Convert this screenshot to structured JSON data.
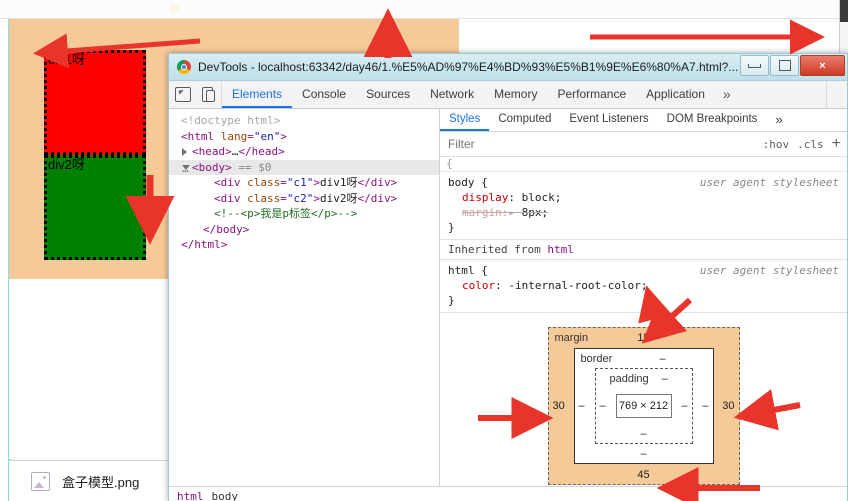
{
  "bookmarks": {
    "items": [
      {
        "label": "   "
      },
      {
        "label": "  "
      },
      {
        "label": "  "
      },
      {
        "label": "  "
      },
      {
        "label": "  "
      },
      {
        "label": "  "
      }
    ]
  },
  "page": {
    "div1_text": "div1呀",
    "div2_text": "div2呀",
    "div1_color": "#ff0000",
    "div2_color": "#008000",
    "body_background": "#f6c998",
    "border_style": "3px dotted #000000"
  },
  "download_shelf": {
    "file_name": "盒子模型.png",
    "icon": "image-file-icon"
  },
  "devtools": {
    "window_title": "DevTools - localhost:63342/day46/1.%E5%AD%97%E4%BD%93%E5%B1%9E%E6%80%A7.html?...",
    "window_controls": {
      "minimize": "minimize-icon",
      "maximize": "maximize-icon",
      "close": "×"
    },
    "toolbar_icons": [
      {
        "name": "inspect-element-icon"
      },
      {
        "name": "device-toolbar-icon"
      }
    ],
    "tabs": [
      {
        "label": "Elements",
        "active": true
      },
      {
        "label": "Console",
        "active": false
      },
      {
        "label": "Sources",
        "active": false
      },
      {
        "label": "Network",
        "active": false
      },
      {
        "label": "Memory",
        "active": false
      },
      {
        "label": "Performance",
        "active": false
      },
      {
        "label": "Application",
        "active": false
      },
      {
        "label": "»",
        "active": false
      }
    ],
    "kebab": "more-options-icon",
    "dom_tree": [
      {
        "indent": 0,
        "parts": [
          {
            "t": "doctype",
            "v": "<!doctype html>"
          }
        ]
      },
      {
        "indent": 0,
        "parts": [
          {
            "t": "punc",
            "v": "<"
          },
          {
            "t": "tag",
            "v": "html"
          },
          {
            "t": "sp",
            "v": " "
          },
          {
            "t": "attrname",
            "v": "lang"
          },
          {
            "t": "punc",
            "v": "="
          },
          {
            "t": "attrval",
            "v": "\"en\""
          },
          {
            "t": "punc",
            "v": ">"
          }
        ]
      },
      {
        "indent": 1,
        "triangle": "closed",
        "parts": [
          {
            "t": "punc",
            "v": "<"
          },
          {
            "t": "tag",
            "v": "head"
          },
          {
            "t": "punc",
            "v": ">"
          },
          {
            "t": "txt",
            "v": "…"
          },
          {
            "t": "punc",
            "v": "</"
          },
          {
            "t": "tag",
            "v": "head"
          },
          {
            "t": "punc",
            "v": ">"
          }
        ]
      },
      {
        "indent": 1,
        "triangle": "open",
        "selected": true,
        "prefix": "…",
        "parts": [
          {
            "t": "punc",
            "v": "<"
          },
          {
            "t": "tag",
            "v": "body"
          },
          {
            "t": "punc",
            "v": ">"
          },
          {
            "t": "sp",
            "v": " "
          },
          {
            "t": "dollar",
            "v": "== $0"
          }
        ]
      },
      {
        "indent": 3,
        "parts": [
          {
            "t": "punc",
            "v": "<"
          },
          {
            "t": "tag",
            "v": "div"
          },
          {
            "t": "sp",
            "v": " "
          },
          {
            "t": "attrname",
            "v": "class"
          },
          {
            "t": "punc",
            "v": "="
          },
          {
            "t": "attrval",
            "v": "\"c1\""
          },
          {
            "t": "punc",
            "v": ">"
          },
          {
            "t": "txt",
            "v": "div1呀"
          },
          {
            "t": "punc",
            "v": "</"
          },
          {
            "t": "tag",
            "v": "div"
          },
          {
            "t": "punc",
            "v": ">"
          }
        ]
      },
      {
        "indent": 3,
        "parts": [
          {
            "t": "punc",
            "v": "<"
          },
          {
            "t": "tag",
            "v": "div"
          },
          {
            "t": "sp",
            "v": " "
          },
          {
            "t": "attrname",
            "v": "class"
          },
          {
            "t": "punc",
            "v": "="
          },
          {
            "t": "attrval",
            "v": "\"c2\""
          },
          {
            "t": "punc",
            "v": ">"
          },
          {
            "t": "txt",
            "v": "div2呀"
          },
          {
            "t": "punc",
            "v": "</"
          },
          {
            "t": "tag",
            "v": "div"
          },
          {
            "t": "punc",
            "v": ">"
          }
        ]
      },
      {
        "indent": 3,
        "parts": [
          {
            "t": "cmt",
            "v": "<!--<p>我是p标签</p>-->"
          }
        ]
      },
      {
        "indent": 2,
        "parts": [
          {
            "t": "punc",
            "v": "</"
          },
          {
            "t": "tag",
            "v": "body"
          },
          {
            "t": "punc",
            "v": ">"
          }
        ]
      },
      {
        "indent": 0,
        "parts": [
          {
            "t": "punc",
            "v": "</"
          },
          {
            "t": "tag",
            "v": "html"
          },
          {
            "t": "punc",
            "v": ">"
          }
        ]
      }
    ],
    "styles_tabs": [
      {
        "label": "Styles",
        "active": true
      },
      {
        "label": "Computed",
        "active": false
      },
      {
        "label": "Event Listeners",
        "active": false
      },
      {
        "label": "DOM Breakpoints",
        "active": false
      },
      {
        "label": "»",
        "active": false
      }
    ],
    "filter": {
      "placeholder": "Filter",
      "value": "",
      "hov_label": ":hov",
      "cls_label": ".cls",
      "plus_label": "+"
    },
    "blank_rule": "{",
    "css_rules": [
      {
        "selector": "body",
        "origin": "user agent stylesheet",
        "declarations": [
          {
            "prop": "display",
            "value": "block;",
            "struck": false
          },
          {
            "prop": "margin:",
            "value": "8px;",
            "struck": true,
            "arrow": "▸"
          }
        ]
      }
    ],
    "inherited_from": {
      "prefix": "Inherited from",
      "element": "html"
    },
    "inherited_rules": [
      {
        "selector": "html",
        "origin": "user agent stylesheet",
        "declarations": [
          {
            "prop": "color",
            "value": "-internal-root-color;",
            "struck": false
          }
        ]
      }
    ],
    "box_model": {
      "margin_label": "margin",
      "border_label": "border",
      "padding_label": "padding",
      "content_size": "769 × 212",
      "margin_top": "15",
      "margin_right": "30",
      "margin_bottom": "45",
      "margin_left": "30",
      "border_top": "–",
      "border_right": "–",
      "border_bottom": "–",
      "border_left": "–",
      "padding_top": "–",
      "padding_right": "–",
      "padding_bottom": "–",
      "padding_left": "–",
      "margin_color": "#f6c998"
    },
    "breadcrumb": [
      {
        "label": "html"
      },
      {
        "label": "body"
      }
    ]
  },
  "annotations": {
    "arrow_color": "#e8342a",
    "arrows": [
      {
        "name": "arrow-to-div1",
        "direction": "left"
      },
      {
        "name": "arrow-down-div-height",
        "direction": "down"
      },
      {
        "name": "arrow-up-margin-top",
        "direction": "up"
      },
      {
        "name": "arrow-right-page-width",
        "direction": "right"
      },
      {
        "name": "arrow-down-to-margin-15",
        "direction": "down-left"
      },
      {
        "name": "arrow-right-to-margin-left-30",
        "direction": "right"
      },
      {
        "name": "arrow-left-to-margin-right-30",
        "direction": "left"
      },
      {
        "name": "arrow-left-to-margin-bottom-45",
        "direction": "left"
      },
      {
        "name": "arrow-to-html-rule",
        "direction": "up-right"
      }
    ]
  }
}
